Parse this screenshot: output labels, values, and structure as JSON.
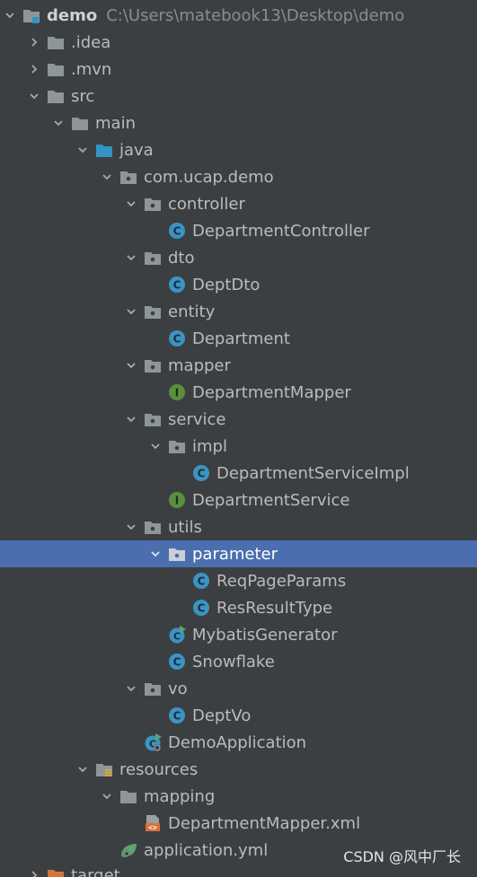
{
  "project": {
    "name": "demo",
    "path": "C:\\Users\\matebook13\\Desktop\\demo"
  },
  "tree": {
    "idea": ".idea",
    "mvn": ".mvn",
    "src": "src",
    "main": "main",
    "java": "java",
    "pkg": "com.ucap.demo",
    "controller": "controller",
    "DepartmentController": "DepartmentController",
    "dto": "dto",
    "DeptDto": "DeptDto",
    "entity": "entity",
    "Department": "Department",
    "mapper": "mapper",
    "DepartmentMapper": "DepartmentMapper",
    "service": "service",
    "impl": "impl",
    "DepartmentServiceImpl": "DepartmentServiceImpl",
    "DepartmentService": "DepartmentService",
    "utils": "utils",
    "parameter": "parameter",
    "ReqPageParams": "ReqPageParams",
    "ResResultType": "ResResultType",
    "MybatisGenerator": "MybatisGenerator",
    "Snowflake": "Snowflake",
    "vo": "vo",
    "DeptVo": "DeptVo",
    "DemoApplication": "DemoApplication",
    "resources": "resources",
    "mapping": "mapping",
    "DepartmentMapperXml": "DepartmentMapper.xml",
    "applicationYml": "application.yml",
    "target": "target"
  },
  "watermark": "CSDN @风中厂长",
  "colors": {
    "background": "#3c3f41",
    "selection": "#4b6eaf",
    "folder": "#8e9699",
    "sourceFolder": "#3592c4",
    "classIcon": "#3a94c4",
    "interfaceIcon": "#5a8f3e",
    "targetFolder": "#d6733a"
  }
}
